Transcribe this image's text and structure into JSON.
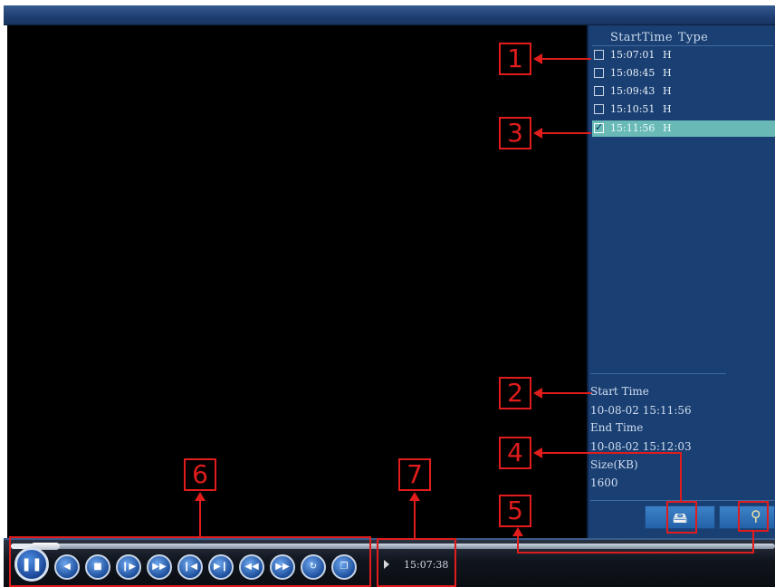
{
  "record_list": {
    "header_starttime": "StartTime",
    "header_type": "Type",
    "items": [
      {
        "time": "15:07:01",
        "type": "H",
        "checked": false
      },
      {
        "time": "15:08:45",
        "type": "H",
        "checked": false
      },
      {
        "time": "15:09:43",
        "type": "H",
        "checked": false
      },
      {
        "time": "15:10:51",
        "type": "H",
        "checked": false
      },
      {
        "time": "15:11:56",
        "type": "H",
        "checked": true
      }
    ]
  },
  "info": {
    "start_label": "Start Time",
    "start_value": "10-08-02 15:11:56",
    "end_label": "End Time",
    "end_value": "10-08-02 15:12:03",
    "size_label": "Size(KB)",
    "size_value": "1600"
  },
  "sidebar_buttons": {
    "backup_icon": "backup-icon",
    "search_icon": "search-icon"
  },
  "playback": {
    "progress": 0.04,
    "time": "15:07:38",
    "controls": [
      {
        "name": "play-pause-button",
        "icon": "pause-icon",
        "glyph": "❚❚"
      },
      {
        "name": "reverse-play-button",
        "icon": "reverse-play-icon",
        "glyph": "◀"
      },
      {
        "name": "stop-button",
        "icon": "stop-icon",
        "glyph": "■"
      },
      {
        "name": "frame-step-button",
        "icon": "frame-step-icon",
        "glyph": "❙▶"
      },
      {
        "name": "fast-forward-button",
        "icon": "fast-forward-icon",
        "glyph": "▶▶"
      },
      {
        "name": "previous-segment-button",
        "icon": "previous-segment-icon",
        "glyph": "❙◀"
      },
      {
        "name": "next-segment-button",
        "icon": "next-segment-icon",
        "glyph": "▶❙"
      },
      {
        "name": "previous-file-button",
        "icon": "previous-file-icon",
        "glyph": "◀◀"
      },
      {
        "name": "next-file-button",
        "icon": "next-file-icon",
        "glyph": "▶▶"
      },
      {
        "name": "repeat-button",
        "icon": "repeat-icon",
        "glyph": "↻"
      },
      {
        "name": "fullscreen-button",
        "icon": "window-icon",
        "glyph": "❐"
      }
    ]
  },
  "annotations": [
    "1",
    "2",
    "3",
    "4",
    "5",
    "6",
    "7"
  ],
  "colors": {
    "accent_red": "#e11c1c",
    "panel_blue": "#1a3f72",
    "selected_row": "#69b9b7"
  }
}
